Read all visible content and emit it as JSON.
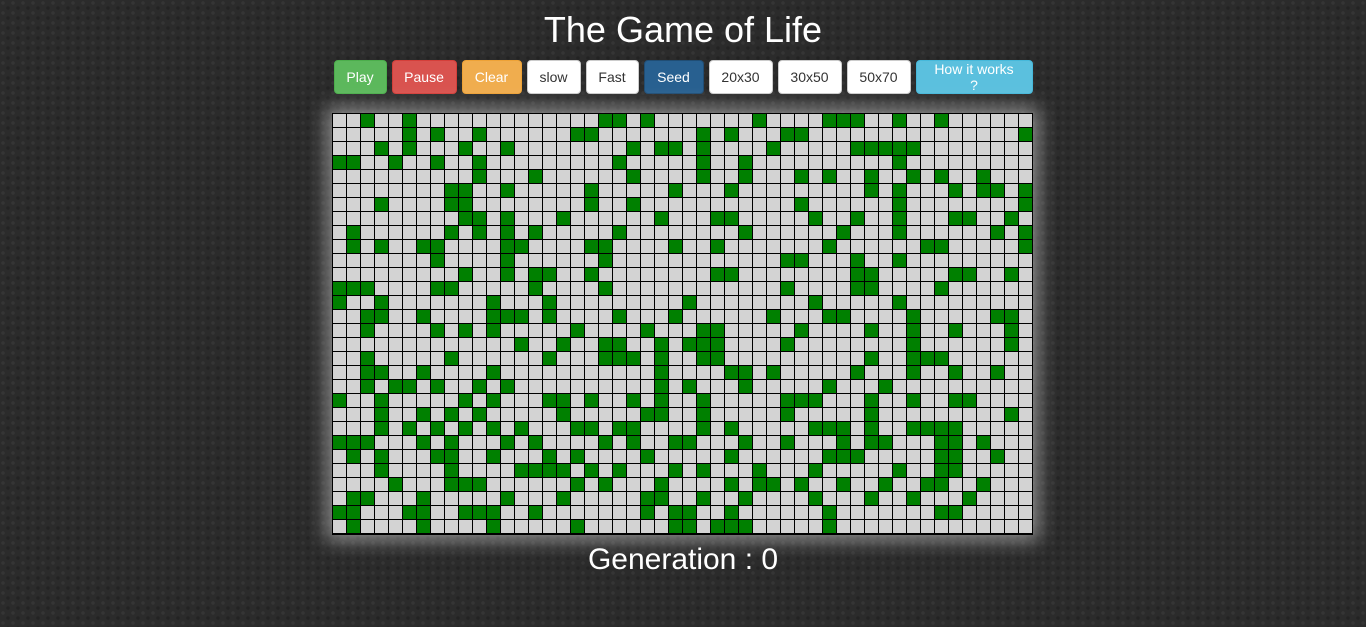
{
  "title": "The Game of Life",
  "toolbar": {
    "play": "Play",
    "pause": "Pause",
    "clear": "Clear",
    "slow": "slow",
    "fast": "Fast",
    "seed": "Seed",
    "size_small": "20x30",
    "size_medium": "30x50",
    "size_large": "50x70",
    "help": "How it works ?"
  },
  "board": {
    "rows": 30,
    "cols": 50,
    "alive_color": "#008000",
    "dead_color": "#d3d3d3",
    "alive": [
      [
        0,
        2
      ],
      [
        0,
        5
      ],
      [
        0,
        19
      ],
      [
        0,
        20
      ],
      [
        0,
        22
      ],
      [
        0,
        30
      ],
      [
        0,
        35
      ],
      [
        0,
        36
      ],
      [
        0,
        37
      ],
      [
        0,
        40
      ],
      [
        0,
        43
      ],
      [
        1,
        5
      ],
      [
        1,
        7
      ],
      [
        1,
        10
      ],
      [
        1,
        17
      ],
      [
        1,
        18
      ],
      [
        1,
        26
      ],
      [
        1,
        28
      ],
      [
        1,
        32
      ],
      [
        1,
        33
      ],
      [
        1,
        49
      ],
      [
        2,
        3
      ],
      [
        2,
        5
      ],
      [
        2,
        9
      ],
      [
        2,
        12
      ],
      [
        2,
        21
      ],
      [
        2,
        23
      ],
      [
        2,
        24
      ],
      [
        2,
        26
      ],
      [
        2,
        31
      ],
      [
        2,
        37
      ],
      [
        2,
        38
      ],
      [
        2,
        39
      ],
      [
        2,
        40
      ],
      [
        2,
        41
      ],
      [
        3,
        0
      ],
      [
        3,
        1
      ],
      [
        3,
        4
      ],
      [
        3,
        7
      ],
      [
        3,
        10
      ],
      [
        3,
        20
      ],
      [
        3,
        26
      ],
      [
        3,
        29
      ],
      [
        3,
        40
      ],
      [
        4,
        10
      ],
      [
        4,
        14
      ],
      [
        4,
        21
      ],
      [
        4,
        26
      ],
      [
        4,
        29
      ],
      [
        4,
        33
      ],
      [
        4,
        35
      ],
      [
        4,
        38
      ],
      [
        4,
        41
      ],
      [
        4,
        43
      ],
      [
        4,
        46
      ],
      [
        5,
        8
      ],
      [
        5,
        9
      ],
      [
        5,
        12
      ],
      [
        5,
        18
      ],
      [
        5,
        24
      ],
      [
        5,
        28
      ],
      [
        5,
        38
      ],
      [
        5,
        40
      ],
      [
        5,
        44
      ],
      [
        5,
        46
      ],
      [
        5,
        47
      ],
      [
        5,
        49
      ],
      [
        6,
        3
      ],
      [
        6,
        8
      ],
      [
        6,
        9
      ],
      [
        6,
        18
      ],
      [
        6,
        21
      ],
      [
        6,
        33
      ],
      [
        6,
        40
      ],
      [
        6,
        49
      ],
      [
        7,
        9
      ],
      [
        7,
        10
      ],
      [
        7,
        12
      ],
      [
        7,
        16
      ],
      [
        7,
        23
      ],
      [
        7,
        27
      ],
      [
        7,
        28
      ],
      [
        7,
        34
      ],
      [
        7,
        37
      ],
      [
        7,
        40
      ],
      [
        7,
        44
      ],
      [
        7,
        45
      ],
      [
        7,
        48
      ],
      [
        8,
        1
      ],
      [
        8,
        8
      ],
      [
        8,
        10
      ],
      [
        8,
        12
      ],
      [
        8,
        14
      ],
      [
        8,
        20
      ],
      [
        8,
        29
      ],
      [
        8,
        36
      ],
      [
        8,
        40
      ],
      [
        8,
        47
      ],
      [
        8,
        49
      ],
      [
        9,
        1
      ],
      [
        9,
        3
      ],
      [
        9,
        6
      ],
      [
        9,
        7
      ],
      [
        9,
        12
      ],
      [
        9,
        13
      ],
      [
        9,
        18
      ],
      [
        9,
        19
      ],
      [
        9,
        24
      ],
      [
        9,
        27
      ],
      [
        9,
        35
      ],
      [
        9,
        42
      ],
      [
        9,
        43
      ],
      [
        9,
        49
      ],
      [
        10,
        7
      ],
      [
        10,
        12
      ],
      [
        10,
        19
      ],
      [
        10,
        32
      ],
      [
        10,
        33
      ],
      [
        10,
        37
      ],
      [
        10,
        40
      ],
      [
        11,
        9
      ],
      [
        11,
        12
      ],
      [
        11,
        14
      ],
      [
        11,
        15
      ],
      [
        11,
        18
      ],
      [
        11,
        27
      ],
      [
        11,
        28
      ],
      [
        11,
        37
      ],
      [
        11,
        38
      ],
      [
        11,
        44
      ],
      [
        11,
        45
      ],
      [
        11,
        48
      ],
      [
        12,
        0
      ],
      [
        12,
        1
      ],
      [
        12,
        2
      ],
      [
        12,
        7
      ],
      [
        12,
        8
      ],
      [
        12,
        14
      ],
      [
        12,
        19
      ],
      [
        12,
        32
      ],
      [
        12,
        37
      ],
      [
        12,
        38
      ],
      [
        12,
        43
      ],
      [
        13,
        0
      ],
      [
        13,
        3
      ],
      [
        13,
        11
      ],
      [
        13,
        15
      ],
      [
        13,
        25
      ],
      [
        13,
        34
      ],
      [
        13,
        40
      ],
      [
        14,
        2
      ],
      [
        14,
        3
      ],
      [
        14,
        6
      ],
      [
        14,
        11
      ],
      [
        14,
        12
      ],
      [
        14,
        13
      ],
      [
        14,
        15
      ],
      [
        14,
        20
      ],
      [
        14,
        24
      ],
      [
        14,
        31
      ],
      [
        14,
        35
      ],
      [
        14,
        36
      ],
      [
        14,
        41
      ],
      [
        14,
        47
      ],
      [
        14,
        48
      ],
      [
        15,
        2
      ],
      [
        15,
        7
      ],
      [
        15,
        9
      ],
      [
        15,
        11
      ],
      [
        15,
        17
      ],
      [
        15,
        22
      ],
      [
        15,
        26
      ],
      [
        15,
        27
      ],
      [
        15,
        33
      ],
      [
        15,
        38
      ],
      [
        15,
        41
      ],
      [
        15,
        44
      ],
      [
        15,
        48
      ],
      [
        16,
        13
      ],
      [
        16,
        16
      ],
      [
        16,
        19
      ],
      [
        16,
        20
      ],
      [
        16,
        23
      ],
      [
        16,
        25
      ],
      [
        16,
        26
      ],
      [
        16,
        27
      ],
      [
        16,
        32
      ],
      [
        16,
        41
      ],
      [
        16,
        48
      ],
      [
        17,
        2
      ],
      [
        17,
        8
      ],
      [
        17,
        15
      ],
      [
        17,
        19
      ],
      [
        17,
        20
      ],
      [
        17,
        21
      ],
      [
        17,
        23
      ],
      [
        17,
        26
      ],
      [
        17,
        27
      ],
      [
        17,
        38
      ],
      [
        17,
        41
      ],
      [
        17,
        42
      ],
      [
        17,
        43
      ],
      [
        18,
        2
      ],
      [
        18,
        3
      ],
      [
        18,
        6
      ],
      [
        18,
        11
      ],
      [
        18,
        23
      ],
      [
        18,
        28
      ],
      [
        18,
        29
      ],
      [
        18,
        31
      ],
      [
        18,
        37
      ],
      [
        18,
        41
      ],
      [
        18,
        44
      ],
      [
        18,
        47
      ],
      [
        19,
        2
      ],
      [
        19,
        4
      ],
      [
        19,
        5
      ],
      [
        19,
        7
      ],
      [
        19,
        10
      ],
      [
        19,
        12
      ],
      [
        19,
        23
      ],
      [
        19,
        25
      ],
      [
        19,
        29
      ],
      [
        19,
        35
      ],
      [
        19,
        39
      ],
      [
        20,
        0
      ],
      [
        20,
        3
      ],
      [
        20,
        9
      ],
      [
        20,
        11
      ],
      [
        20,
        15
      ],
      [
        20,
        16
      ],
      [
        20,
        18
      ],
      [
        20,
        21
      ],
      [
        20,
        23
      ],
      [
        20,
        26
      ],
      [
        20,
        32
      ],
      [
        20,
        33
      ],
      [
        20,
        34
      ],
      [
        20,
        38
      ],
      [
        20,
        41
      ],
      [
        20,
        44
      ],
      [
        20,
        45
      ],
      [
        21,
        3
      ],
      [
        21,
        6
      ],
      [
        21,
        8
      ],
      [
        21,
        10
      ],
      [
        21,
        16
      ],
      [
        21,
        22
      ],
      [
        21,
        23
      ],
      [
        21,
        26
      ],
      [
        21,
        32
      ],
      [
        21,
        38
      ],
      [
        21,
        48
      ],
      [
        22,
        3
      ],
      [
        22,
        5
      ],
      [
        22,
        7
      ],
      [
        22,
        9
      ],
      [
        22,
        11
      ],
      [
        22,
        13
      ],
      [
        22,
        17
      ],
      [
        22,
        18
      ],
      [
        22,
        20
      ],
      [
        22,
        21
      ],
      [
        22,
        26
      ],
      [
        22,
        28
      ],
      [
        22,
        34
      ],
      [
        22,
        35
      ],
      [
        22,
        36
      ],
      [
        22,
        38
      ],
      [
        22,
        41
      ],
      [
        22,
        42
      ],
      [
        22,
        43
      ],
      [
        22,
        44
      ],
      [
        23,
        0
      ],
      [
        23,
        1
      ],
      [
        23,
        2
      ],
      [
        23,
        6
      ],
      [
        23,
        8
      ],
      [
        23,
        12
      ],
      [
        23,
        14
      ],
      [
        23,
        19
      ],
      [
        23,
        21
      ],
      [
        23,
        24
      ],
      [
        23,
        25
      ],
      [
        23,
        29
      ],
      [
        23,
        32
      ],
      [
        23,
        36
      ],
      [
        23,
        38
      ],
      [
        23,
        39
      ],
      [
        23,
        43
      ],
      [
        23,
        44
      ],
      [
        23,
        46
      ],
      [
        24,
        1
      ],
      [
        24,
        3
      ],
      [
        24,
        7
      ],
      [
        24,
        8
      ],
      [
        24,
        11
      ],
      [
        24,
        15
      ],
      [
        24,
        17
      ],
      [
        24,
        22
      ],
      [
        24,
        28
      ],
      [
        24,
        35
      ],
      [
        24,
        36
      ],
      [
        24,
        37
      ],
      [
        24,
        43
      ],
      [
        24,
        44
      ],
      [
        24,
        47
      ],
      [
        25,
        3
      ],
      [
        25,
        8
      ],
      [
        25,
        13
      ],
      [
        25,
        14
      ],
      [
        25,
        15
      ],
      [
        25,
        16
      ],
      [
        25,
        18
      ],
      [
        25,
        20
      ],
      [
        25,
        24
      ],
      [
        25,
        26
      ],
      [
        25,
        30
      ],
      [
        25,
        34
      ],
      [
        25,
        40
      ],
      [
        25,
        43
      ],
      [
        25,
        44
      ],
      [
        26,
        4
      ],
      [
        26,
        8
      ],
      [
        26,
        9
      ],
      [
        26,
        10
      ],
      [
        26,
        17
      ],
      [
        26,
        19
      ],
      [
        26,
        23
      ],
      [
        26,
        28
      ],
      [
        26,
        30
      ],
      [
        26,
        31
      ],
      [
        26,
        33
      ],
      [
        26,
        36
      ],
      [
        26,
        39
      ],
      [
        26,
        42
      ],
      [
        26,
        43
      ],
      [
        26,
        46
      ],
      [
        27,
        1
      ],
      [
        27,
        2
      ],
      [
        27,
        6
      ],
      [
        27,
        12
      ],
      [
        27,
        16
      ],
      [
        27,
        22
      ],
      [
        27,
        23
      ],
      [
        27,
        26
      ],
      [
        27,
        29
      ],
      [
        27,
        34
      ],
      [
        27,
        38
      ],
      [
        27,
        41
      ],
      [
        27,
        45
      ],
      [
        28,
        0
      ],
      [
        28,
        1
      ],
      [
        28,
        5
      ],
      [
        28,
        6
      ],
      [
        28,
        9
      ],
      [
        28,
        10
      ],
      [
        28,
        11
      ],
      [
        28,
        14
      ],
      [
        28,
        22
      ],
      [
        28,
        24
      ],
      [
        28,
        25
      ],
      [
        28,
        28
      ],
      [
        28,
        35
      ],
      [
        28,
        43
      ],
      [
        28,
        44
      ],
      [
        29,
        1
      ],
      [
        29,
        6
      ],
      [
        29,
        11
      ],
      [
        29,
        17
      ],
      [
        29,
        24
      ],
      [
        29,
        25
      ],
      [
        29,
        27
      ],
      [
        29,
        28
      ],
      [
        29,
        29
      ],
      [
        29,
        35
      ]
    ]
  },
  "status": {
    "generation_label": "Generation : 0"
  }
}
